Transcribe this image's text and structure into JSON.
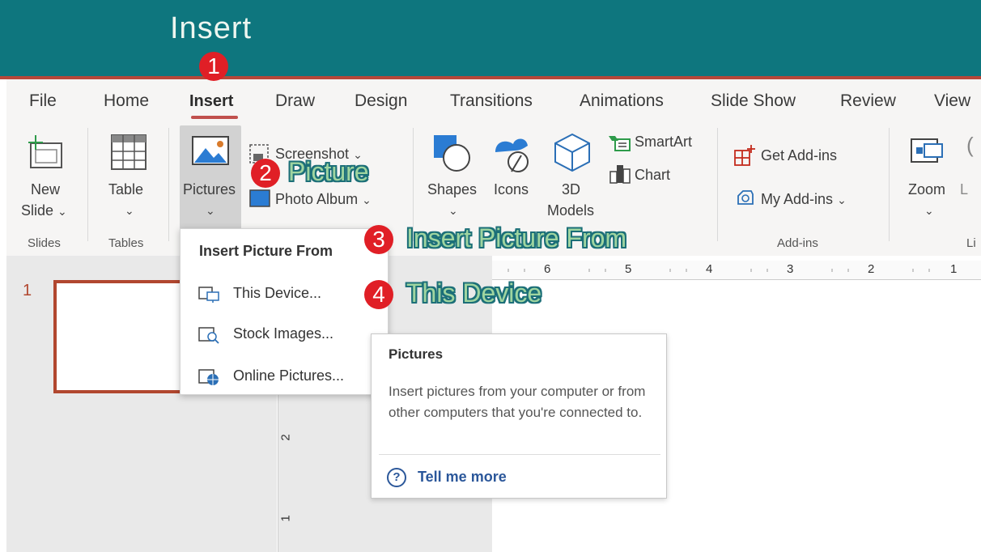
{
  "window": {
    "title": "Insert"
  },
  "tabs": [
    "File",
    "Home",
    "Insert",
    "Draw",
    "Design",
    "Transitions",
    "Animations",
    "Slide Show",
    "Review",
    "View"
  ],
  "ribbon": {
    "new_slide": "New",
    "new_slide_line2": "Slide",
    "table": "Table",
    "pictures": "Pictures",
    "screenshot": "Screenshot",
    "photo_album": "Photo Album",
    "shapes": "Shapes",
    "icons": "Icons",
    "three_d": "3D",
    "three_d_line2": "Models",
    "smartart": "SmartArt",
    "chart": "Chart",
    "get_addins": "Get Add-ins",
    "my_addins": "My Add-ins",
    "zoom": "Zoom",
    "link_partial": "L",
    "groups": {
      "slides": "Slides",
      "tables": "Tables",
      "addins": "Add-ins",
      "links_partial": "Li"
    },
    "chevron": "⌄"
  },
  "slides_pane": {
    "slide_number": "1"
  },
  "ruler": {
    "h_numbers": [
      "6",
      "5",
      "4",
      "3",
      "2",
      "1"
    ],
    "v_numbers": [
      "2",
      "1"
    ]
  },
  "dropdown": {
    "title": "Insert Picture From",
    "items": [
      "This Device...",
      "Stock Images...",
      "Online Pictures..."
    ]
  },
  "tooltip": {
    "title": "Pictures",
    "body": "Insert pictures from your computer or from other computers that you're connected to.",
    "link": "Tell me more",
    "help_glyph": "?"
  },
  "annotations": {
    "step1": "1",
    "step2": "2",
    "step2_label": "Picture",
    "step3": "3",
    "step3_label": "Insert Picture From",
    "step4": "4",
    "step4_label": "This Device"
  },
  "colors": {
    "title_bar": "#0e767e",
    "accent_red": "#b6473a",
    "badge_red": "#e01f26",
    "link_blue": "#2b579a"
  }
}
